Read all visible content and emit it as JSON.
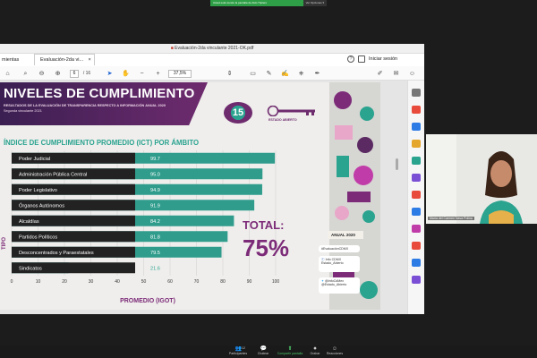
{
  "zoom": {
    "share_status": "Usted está viendo la pantalla de Aldo Triplero",
    "stop_label": "Ver Opciones ▾",
    "participant_name": "María del Carmen Nava Polina",
    "bottom_bar": [
      {
        "label": "Participantes",
        "count": "12",
        "icon": "participants-icon"
      },
      {
        "label": "Chatear",
        "icon": "chat-icon"
      },
      {
        "label": "Compartir pantalla",
        "icon": "share-screen-icon"
      },
      {
        "label": "Grabar",
        "icon": "record-icon"
      },
      {
        "label": "Reacciones",
        "icon": "reactions-icon"
      }
    ]
  },
  "acrobat": {
    "window_title": "Evaluación-2da vinculante 2021-OK.pdf",
    "tab_tools": "mientas",
    "tab_document": "Evaluación-2da vi...",
    "sign_in": "Iniciar sesión",
    "page_current": "6",
    "page_total": "/ 16",
    "zoom": "37,5%"
  },
  "slide": {
    "title": "NIVELES DE CUMPLIMIENTO",
    "subtitle": "RESULTADOS DE LA EVALUACIÓN DE TRANSPARENCIA RESPECTO A INFORMACIÓN ANUAL 2020",
    "subtitle2": "Segunda vinculante 2021",
    "logo_number": "15",
    "logo_key_text": "ESTADO ABIERTO",
    "chart_title": "ÍNDICE DE CUMPLIMIENTO PROMEDIO (ICT) POR ÁMBITO",
    "total_label": "TOTAL:",
    "total_value": "75%",
    "anual": "ANUAL 2020",
    "hashtag": "#EvaluaciónCDMX",
    "facebook": [
      "Info CDMX",
      "Estado_Abierto"
    ],
    "twitter": [
      "@InfoCdMex",
      "@Estado_Abierto"
    ]
  },
  "chart_data": {
    "type": "bar",
    "orientation": "horizontal",
    "categories": [
      "Poder Judicial",
      "Administración Pública Central",
      "Poder Legislativo",
      "Órganos Autónomos",
      "Alcaldías",
      "Partidos Políticos",
      "Desconcentrados y Paraestatales",
      "Sindicatos"
    ],
    "values": [
      99.7,
      95.0,
      94.9,
      91.9,
      84.2,
      81.8,
      79.5,
      21.6
    ],
    "value_labels": [
      "99.7",
      "95.0",
      "94.9",
      "91.9",
      "84.2",
      "81.8",
      "79.5",
      "21.6"
    ],
    "xlabel": "PROMEDIO (IGOT)",
    "ylabel": "TIPO",
    "xlim": [
      0,
      100
    ],
    "xticks": [
      "0",
      "10",
      "20",
      "30",
      "40",
      "50",
      "60",
      "70",
      "80",
      "90",
      "100"
    ],
    "bar_color": "#2f9c8c",
    "label_color": "#222222"
  }
}
